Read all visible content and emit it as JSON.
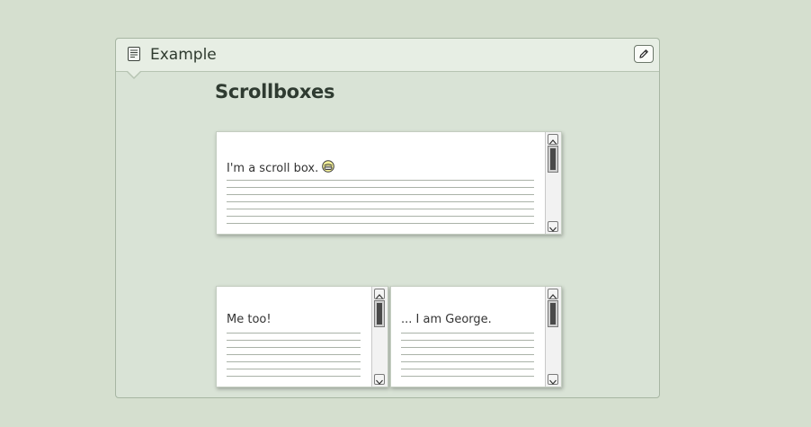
{
  "panel": {
    "title": "Example",
    "title_icon": "document-icon",
    "edit_icon": "pencil-icon"
  },
  "heading": "Scrollboxes",
  "scrollboxes": [
    {
      "text": "I'm a scroll box.",
      "emoticon": "grin-smiley-icon"
    },
    {
      "text": "Me too!"
    },
    {
      "text": "... I am George."
    }
  ],
  "colors": {
    "page_background": "#d5dfcf",
    "panel_background": "#d9e3d6",
    "header_background": "#e7eee4",
    "ruled_line": "#aab2a8"
  }
}
